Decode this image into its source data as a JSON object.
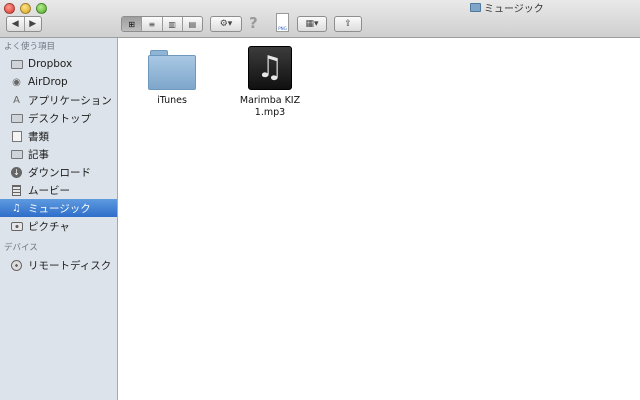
{
  "window": {
    "title": "ミュージック"
  },
  "toolbar": {
    "back_glyph": "◀",
    "forward_glyph": "▶",
    "view_icons": [
      "⊞",
      "≡",
      "▥",
      "▤"
    ],
    "action_glyph": "⚙▾",
    "help_glyph": "?",
    "png_label": "PNG",
    "arrange_glyph": "▦▾",
    "share_glyph": "⇪"
  },
  "sidebar": {
    "favorites_heading": "よく使う項目",
    "favorites": [
      {
        "label": "Dropbox",
        "icon": "dropbox-icon"
      },
      {
        "label": "AirDrop",
        "icon": "airdrop-icon"
      },
      {
        "label": "アプリケーション",
        "icon": "applications-icon"
      },
      {
        "label": "デスクトップ",
        "icon": "desktop-icon"
      },
      {
        "label": "書類",
        "icon": "documents-icon"
      },
      {
        "label": "記事",
        "icon": "folder-icon"
      },
      {
        "label": "ダウンロード",
        "icon": "downloads-icon"
      },
      {
        "label": "ムービー",
        "icon": "movies-icon"
      },
      {
        "label": "ミュージック",
        "icon": "music-icon",
        "selected": true
      },
      {
        "label": "ピクチャ",
        "icon": "pictures-icon"
      }
    ],
    "devices_heading": "デバイス",
    "devices": [
      {
        "label": "リモートディスク",
        "icon": "remote-disc-icon"
      }
    ]
  },
  "files": [
    {
      "name": "iTunes",
      "kind": "folder"
    },
    {
      "name": "Marimba KIZ\n1.mp3",
      "kind": "audio"
    }
  ],
  "colors": {
    "selection": "#3a7bd5",
    "sidebar_bg": "#dde3ea"
  }
}
